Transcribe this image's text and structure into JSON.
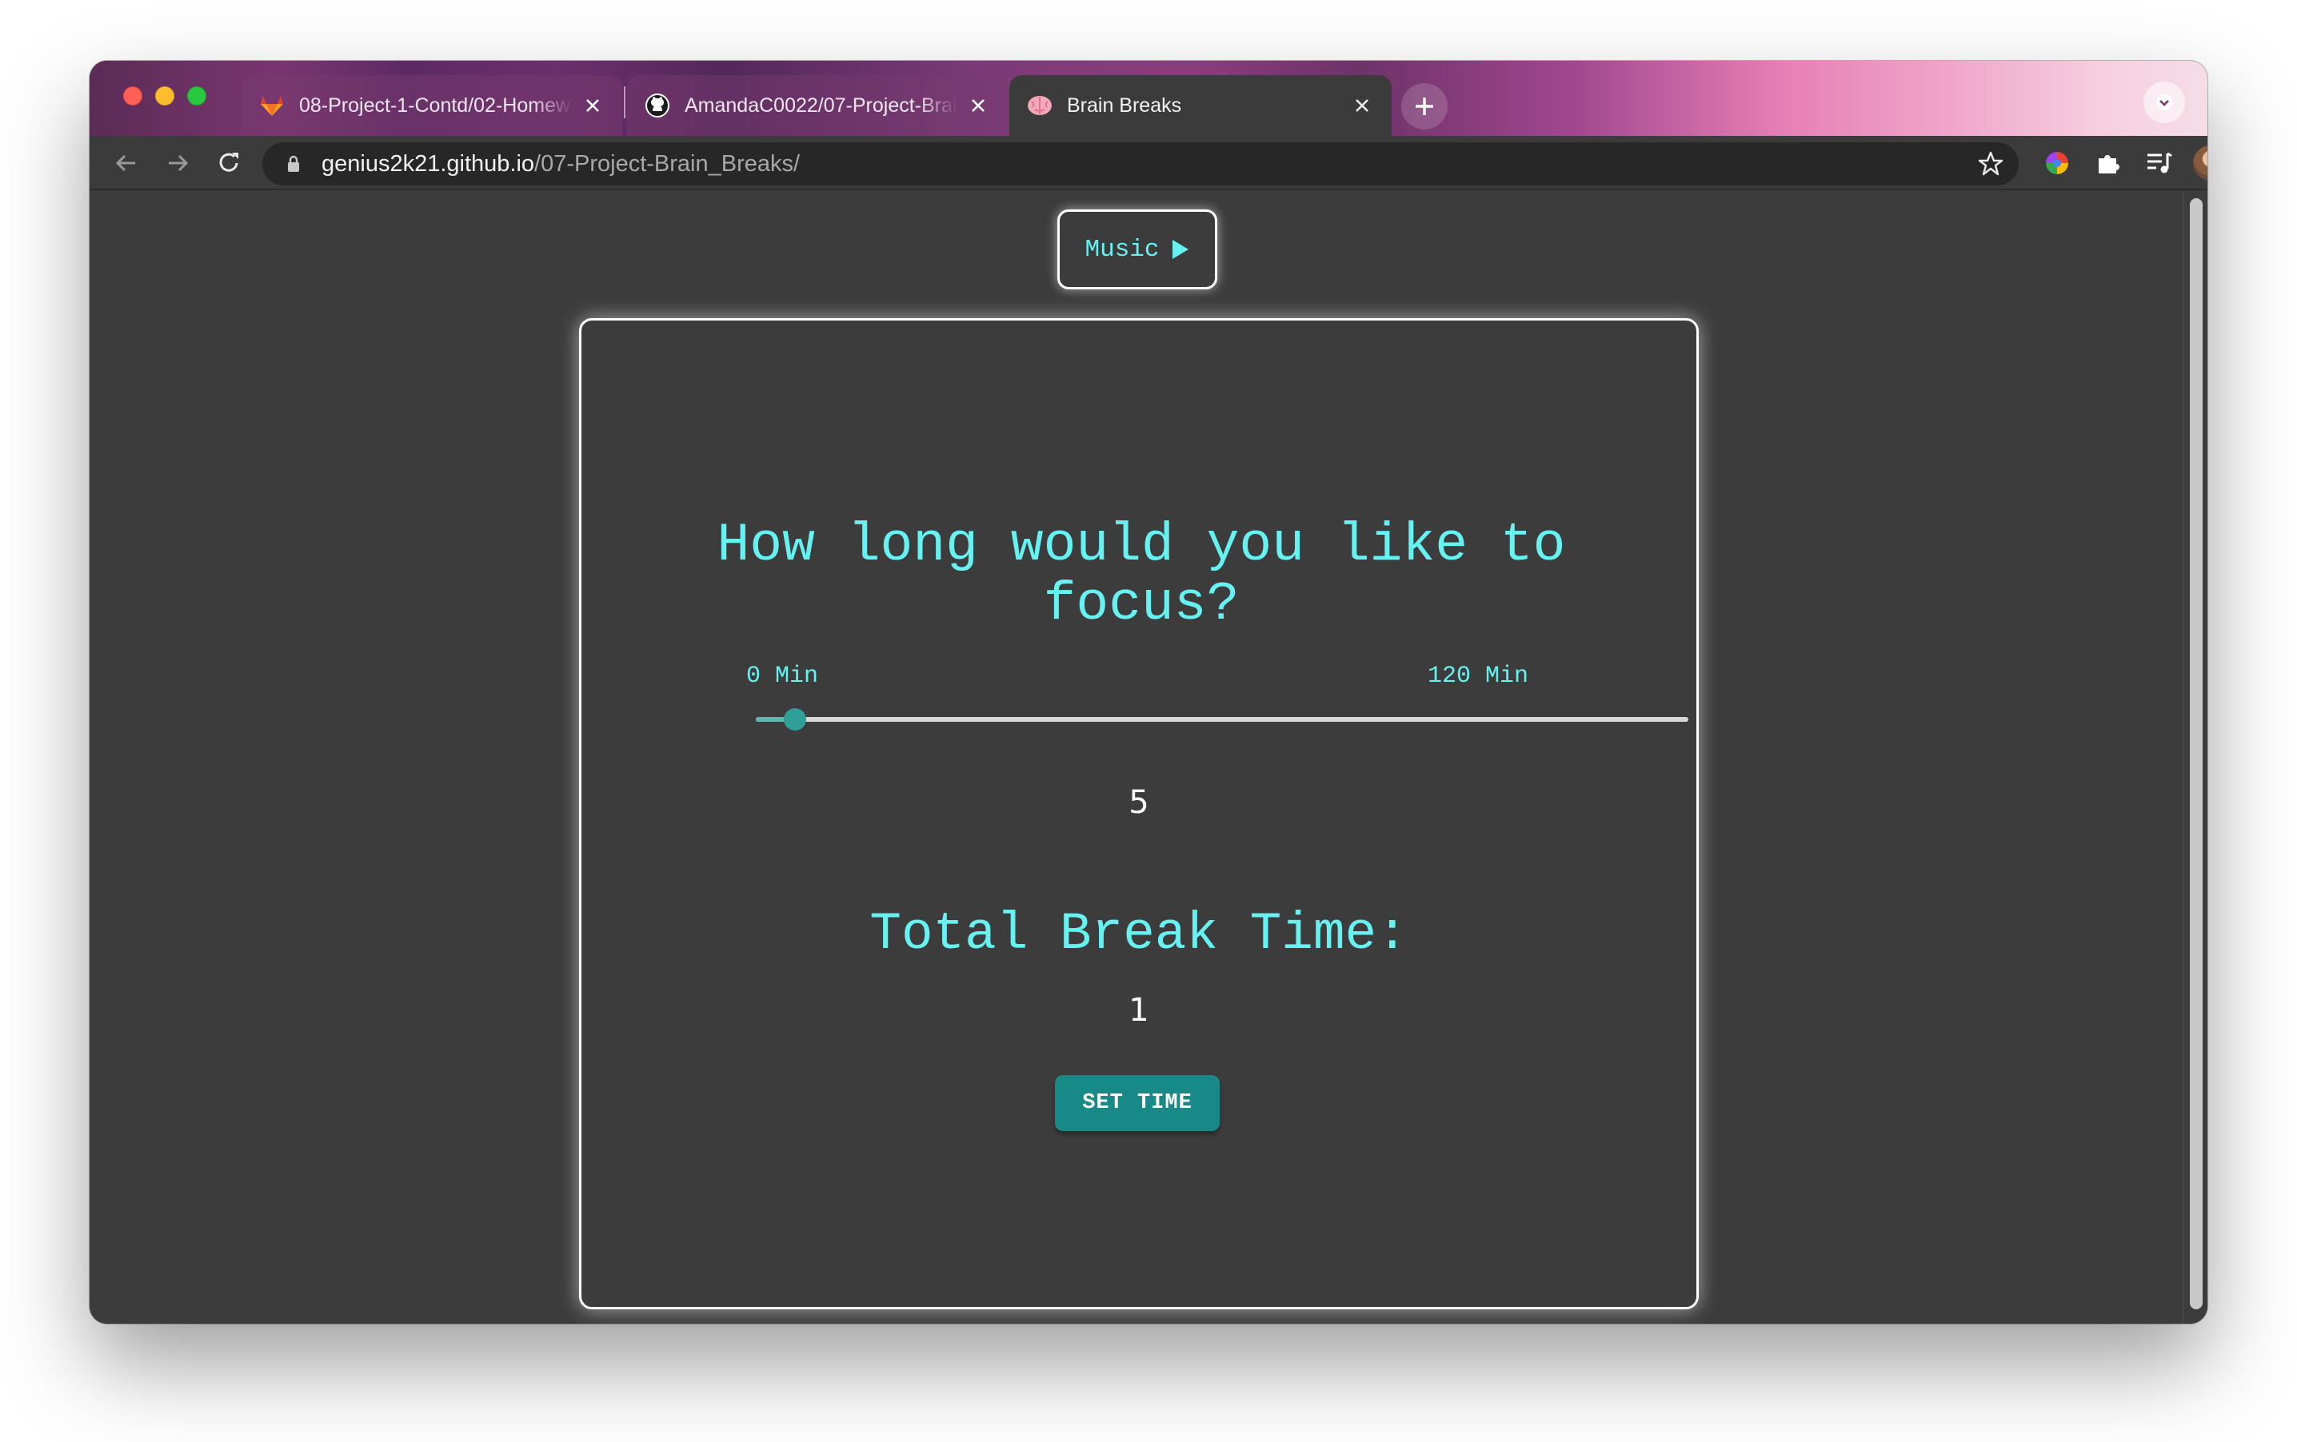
{
  "browser": {
    "tabs": [
      {
        "title": "08-Project-1-Contd/02-Homew",
        "favicon": "gitlab-icon",
        "active": false
      },
      {
        "title": "AmandaC0022/07-Project-Brai",
        "favicon": "github-icon",
        "active": false
      },
      {
        "title": "Brain Breaks",
        "favicon": "brain-icon",
        "active": true
      }
    ],
    "url_host": "genius2k21.github.io",
    "url_path": "/07-Project-Brain_Breaks/"
  },
  "page": {
    "music_label": "Music",
    "question": "How long would you like to focus?",
    "range_min_label": "0 Min",
    "range_max_label": "120 Min",
    "slider": {
      "min": 0,
      "max": 120,
      "value": 5
    },
    "focus_value": "5",
    "break_heading": "Total Break Time:",
    "break_value": "1",
    "set_time_label": "SET TIME"
  },
  "colors": {
    "accent_text": "#67f2f2",
    "button_bg": "#178a87",
    "page_bg": "#3c3c3c"
  }
}
